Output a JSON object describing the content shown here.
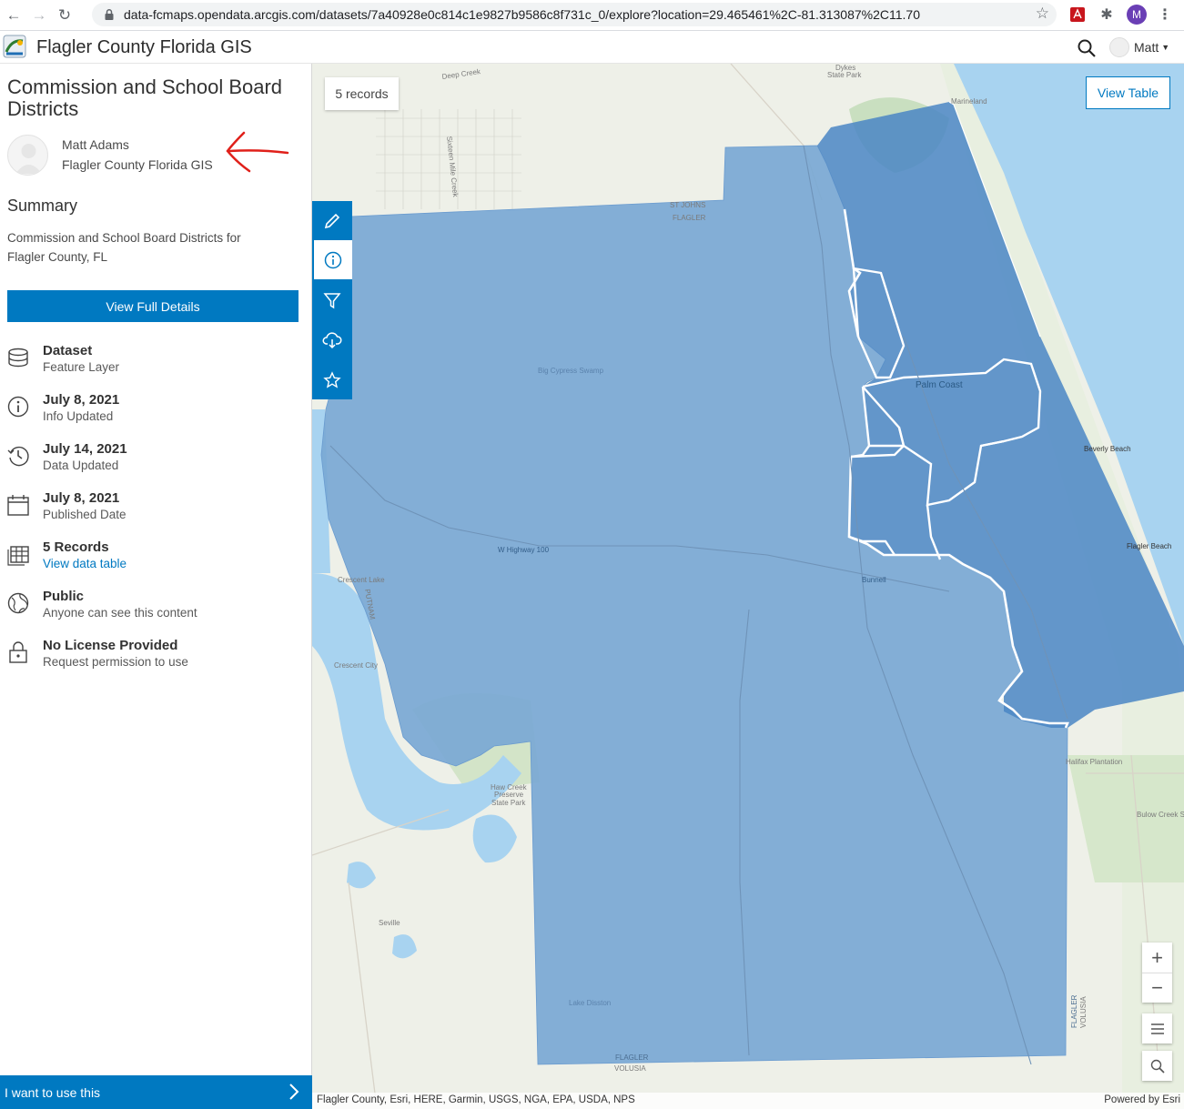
{
  "browser": {
    "url": "data-fcmaps.opendata.arcgis.com/datasets/7a40928e0c814c1e9827b9586c8f731c_0/explore?location=29.465461%2C-81.313087%2C11.70",
    "profile_initial": "M"
  },
  "header": {
    "site_title": "Flagler County Florida GIS",
    "user_name": "Matt"
  },
  "sidebar": {
    "title": "Commission and School Board Districts",
    "owner_name": "Matt Adams",
    "owner_org": "Flagler County Florida GIS",
    "summary_heading": "Summary",
    "summary_text": "Commission and School Board Districts for Flagler County, FL",
    "full_details_label": "View Full Details",
    "meta": [
      {
        "icon": "dataset-icon",
        "title": "Dataset",
        "sub": "Feature Layer"
      },
      {
        "icon": "info-icon",
        "title": "July 8, 2021",
        "sub": "Info Updated"
      },
      {
        "icon": "history-icon",
        "title": "July 14, 2021",
        "sub": "Data Updated"
      },
      {
        "icon": "calendar-icon",
        "title": "July 8, 2021",
        "sub": "Published Date"
      },
      {
        "icon": "table-icon",
        "title": "5 Records",
        "sub": "View data table"
      },
      {
        "icon": "globe-icon",
        "title": "Public",
        "sub": "Anyone can see this content"
      },
      {
        "icon": "lock-icon",
        "title": "No License Provided",
        "sub": "Request permission to use"
      }
    ],
    "use_label": "I want to use this"
  },
  "map": {
    "records_label": "5 records",
    "view_table_label": "View Table",
    "attribution": "Flagler County, Esri, HERE, Garmin, USGS, NGA, EPA, USDA, NPS",
    "powered_by": "Powered by Esri",
    "labels": {
      "deep_creek": "Deep Creek",
      "dykes": "Dykes",
      "state_park": "State Park",
      "marineland": "Marineland",
      "st_johns": "ST JOHNS",
      "flagler_top": "FLAGLER",
      "sixteen_mile": "Sixteen Mile Creek",
      "palm_coast": "Palm Coast",
      "beverly_beach": "Beverly Beach",
      "flagler_beach": "Flagler Beach",
      "bunnell": "Bunnell",
      "hwy100": "W Highway 100",
      "crescent_lake": "Crescent Lake",
      "crescent_city": "Crescent City",
      "putnam": "PUTNAM",
      "haw_creek": "Haw Creek",
      "preserve": "Preserve",
      "state_park2": "State Park",
      "seville": "Seville",
      "volusia_bottom": "VOLUSIA",
      "flagler_bottom": "FLAGLER",
      "volusia_right": "VOLUSIA",
      "flagler_right": "FLAGLER",
      "halifax": "Halifax Plantation",
      "bulow": "Bulow Creek State Park",
      "lake_disston": "Lake Disston",
      "big_cypress": "Big Cypress Swamp"
    },
    "colors": {
      "district_light": "#7aa8d4",
      "district_dark": "#4a86c4",
      "accent": "#0079c1",
      "water": "#a8d3f0"
    }
  }
}
